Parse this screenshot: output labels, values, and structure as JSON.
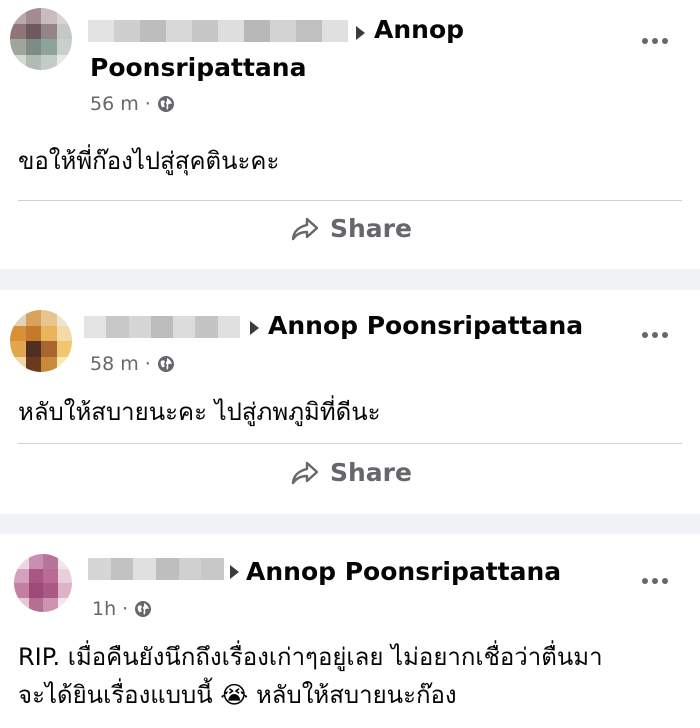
{
  "posts": [
    {
      "target": "Annop",
      "target_line2": "Poonsripattana",
      "time": "56 m",
      "text": "ขอให้พี่ก๊องไปสู่สุคตินะคะ",
      "share_label": "Share",
      "audience_icon": "globe-icon",
      "menu_icon": "more-options-icon"
    },
    {
      "target": "Annop Poonsripattana",
      "time": "58 m",
      "text": "หลับให้สบายนะคะ ไปสู่ภพภูมิที่ดีนะ",
      "share_label": "Share",
      "audience_icon": "globe-icon",
      "menu_icon": "more-options-icon"
    },
    {
      "target": "Annop Poonsripattana",
      "time": "1h",
      "text_line1": "RIP. เมื่อคืนยังนึกถึงเรื่องเก่าๆอยู่เลย ไม่อยากเชื่อว่าตื่นมา",
      "text_line2": "จะได้ยินเรื่องแบบนี้ 😭 หลับให้สบายนะก๊อง",
      "audience_icon": "globe-icon",
      "menu_icon": "more-options-icon"
    }
  ],
  "colors": {
    "background": "#f0f2f5",
    "card": "#ffffff",
    "secondary_text": "#65676b",
    "divider": "#ced0d4"
  }
}
